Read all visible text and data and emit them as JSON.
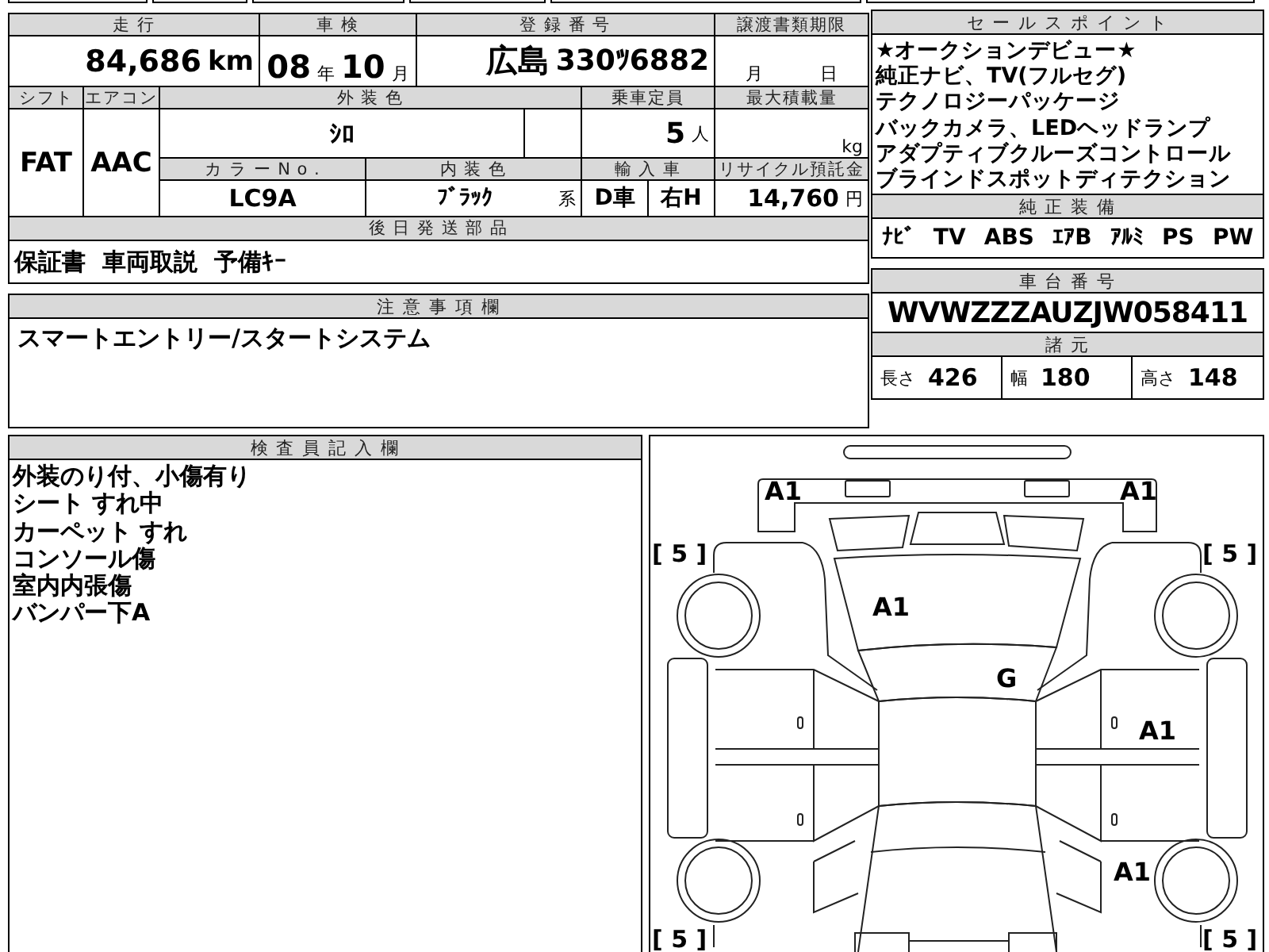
{
  "vehicle_table": {
    "mileage": {
      "label": "走 行",
      "value": "84,686",
      "unit": "km"
    },
    "inspection": {
      "label": "車 検",
      "year": "08",
      "year_unit": "年",
      "month": "10",
      "month_unit": "月"
    },
    "registration": {
      "label": "登 録 番 号",
      "region": "広島",
      "number": "330ﾂ6882"
    },
    "transfer_deadline": {
      "label": "譲渡書類期限",
      "month_unit": "月",
      "day_unit": "日"
    },
    "shift": {
      "label": "シフト",
      "value": "FAT"
    },
    "aircon": {
      "label": "エアコン",
      "value": "AAC"
    },
    "exterior_color": {
      "label": "外 装 色",
      "value": "ｼﾛ"
    },
    "capacity": {
      "label": "乗車定員",
      "value": "5",
      "unit": "人"
    },
    "max_load": {
      "label": "最大積載量",
      "unit": "kg"
    },
    "color_no": {
      "label": "カ ラ ー N o .",
      "value": "LC9A"
    },
    "interior_color": {
      "label": "内 装 色",
      "value": "ﾌﾞﾗｯｸ",
      "suffix": "系"
    },
    "import": {
      "label": "輸 入 車",
      "dealer": "D車",
      "steering": "右H"
    },
    "recycle": {
      "label": "リサイクル預託金",
      "value": "14,760",
      "unit": "円"
    },
    "parts": {
      "label": "後 日 発 送 部 品",
      "value": "保証書  車両取説  予備ｷｰ"
    }
  },
  "caution": {
    "label": "注 意 事 項 欄",
    "text": "スマートエントリー/スタートシステム"
  },
  "sale_points": {
    "label": "セ ー ル ス ポ イ ン ト",
    "lines": [
      "★オークションデビュー★",
      "純正ナビ、TV(フルセグ)",
      "テクノロジーパッケージ",
      "バックカメラ、LEDヘッドランプ",
      "アダプティブクルーズコントロール",
      "ブラインドスポットディテクション"
    ]
  },
  "equipment": {
    "label": "純 正 装 備",
    "items": [
      "ﾅﾋﾞ",
      "TV",
      "ABS",
      "ｴｱB",
      "ｱﾙﾐ",
      "PS",
      "PW"
    ]
  },
  "chassis": {
    "label": "車 台 番 号",
    "vin": "WVWZZZAUZJW058411"
  },
  "specs": {
    "label": "諸 元",
    "items": [
      {
        "label": "長さ",
        "value": "426"
      },
      {
        "label": "幅",
        "value": "180"
      },
      {
        "label": "高さ",
        "value": "148"
      }
    ]
  },
  "inspector_notes": {
    "label": "検 査 員 記 入 欄",
    "lines": [
      "外装のり付、小傷有り",
      "シート すれ中",
      "カーペット すれ",
      "コンソール傷",
      "室内内張傷",
      "バンパー下A"
    ]
  },
  "diagram": {
    "marks": {
      "rear_left_corner": "A1",
      "rear_right_corner": "A1",
      "rear_glass": "A1",
      "roof": "G",
      "right_rear_door": "A1",
      "right_front_fender": "A1"
    },
    "tires": {
      "rear_left": "[ 5 ]",
      "rear_right": "[ 5 ]",
      "front_left": "[ 5 ]",
      "front_right": "[ 5 ]"
    }
  }
}
